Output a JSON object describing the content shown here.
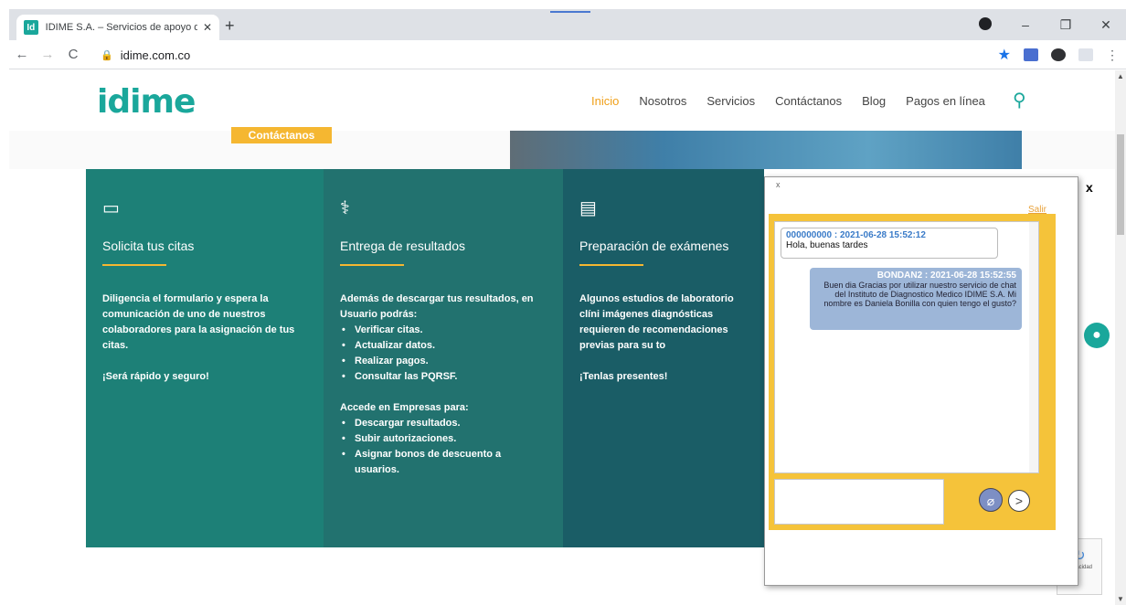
{
  "browser": {
    "tab_title": "IDIME S.A. – Servicios de apoyo d",
    "favicon_text": "Id",
    "url": "idime.com.co",
    "new_tab": "+",
    "tab_close": "✕"
  },
  "site": {
    "logo": "idime",
    "nav": [
      "Inicio",
      "Nosotros",
      "Servicios",
      "Contáctanos",
      "Blog",
      "Pagos en línea"
    ],
    "hero_button": "Contáctanos"
  },
  "cards": [
    {
      "title": "Solicita tus citas",
      "icon": "calendar-icon",
      "p1": "Diligencia el formulario y espera la comunicación de uno de nuestros colaboradores para la asignación de tus citas.",
      "p2": "¡Será rápido y seguro!"
    },
    {
      "title": "Entrega de resultados",
      "icon": "results-icon",
      "intro": "Además de descargar tus resultados, en Usuario podrás:",
      "list1": [
        "Verificar citas.",
        "Actualizar datos.",
        "Realizar pagos.",
        "Consultar las PQRSF."
      ],
      "intro2": "Accede en Empresas para:",
      "list2": [
        "Descargar resultados.",
        "Subir autorizaciones.",
        "Asignar bonos de descuento a usuarios."
      ]
    },
    {
      "title": "Preparación de exámenes",
      "icon": "document-icon",
      "p1": "Algunos estudios de laboratorio clíni imágenes diagnósticas requieren de recomendaciones previas para su to",
      "p2": "¡Tenlas presentes!"
    }
  ],
  "chat": {
    "close": "x",
    "exit": "Salir",
    "messages": [
      {
        "who": "000000000 : 2021-06-28 15:52:12",
        "text": "Hola, buenas tardes"
      },
      {
        "who": "BONDAN2 : 2021-06-28 15:52:55",
        "text": "Buen dia Gracias por utilizar nuestro servicio de chat del Instituto de Diagnostico Medico IDIME S.A. Mi nombre es Daniela Bonilla con quien tengo el gusto?"
      }
    ],
    "send": ">"
  },
  "overlay_close": "x",
  "recaptcha_text": "Privacidad"
}
